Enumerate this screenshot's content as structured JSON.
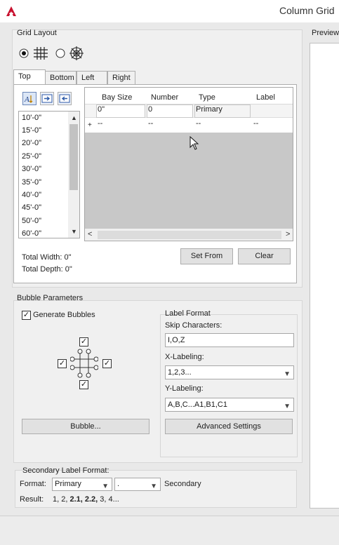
{
  "window": {
    "title": "Column Grid"
  },
  "grid_layout": {
    "label": "Grid Layout",
    "tabs": [
      {
        "label": "Top"
      },
      {
        "label": "Bottom"
      },
      {
        "label": "Left"
      },
      {
        "label": "Right"
      }
    ],
    "spacing_list": [
      "10'-0\"",
      "15'-0\"",
      "20'-0\"",
      "25'-0\"",
      "30'-0\"",
      "35'-0\"",
      "40'-0\"",
      "45'-0\"",
      "50'-0\"",
      "60'-0\""
    ],
    "table": {
      "columns": [
        "Bay Size",
        "Number",
        "Type",
        "Label"
      ],
      "row1": [
        "0\"",
        "0",
        "Primary",
        ""
      ],
      "row2_marker": "+",
      "row2": [
        "--",
        "--",
        "--",
        "--"
      ]
    },
    "total_width": "Total Width: 0\"",
    "total_depth": "Total Depth: 0\"",
    "set_from_label": "Set From",
    "clear_label": "Clear"
  },
  "preview": {
    "label": "Preview"
  },
  "bubble_parameters": {
    "label": "Bubble Parameters",
    "generate_bubbles_label": "Generate Bubbles",
    "bubble_button_label": "Bubble...",
    "label_format": {
      "label": "Label Format",
      "skip_characters_label": "Skip Characters:",
      "skip_characters_value": "I,O,Z",
      "x_labeling_label": "X-Labeling:",
      "x_labeling_value": "1,2,3...",
      "y_labeling_label": "Y-Labeling:",
      "y_labeling_value": "A,B,C...A1,B1,C1",
      "advanced_settings_label": "Advanced Settings"
    }
  },
  "secondary": {
    "label": "Secondary Label Format:",
    "format_label": "Format:",
    "format_value": "Primary",
    "separator_value": ".",
    "secondary_text": "Secondary",
    "result_label": "Result:",
    "result_plain1": "1, 2,",
    "result_bold": "2.1, 2.2,",
    "result_plain2": "3, 4..."
  },
  "colors": {
    "accent": "#c8102e",
    "selection": "#c8c8c8"
  },
  "icons": [
    "autocad-logo-icon",
    "radio-selected-icon",
    "rectangular-grid-icon",
    "radio-unselected-icon",
    "radial-grid-icon",
    "sort-icon",
    "insert-row-icon",
    "delete-row-icon",
    "mouse-cursor-icon"
  ]
}
